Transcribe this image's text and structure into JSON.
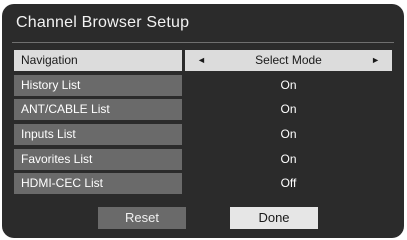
{
  "title": "Channel Browser Setup",
  "menu": {
    "items": [
      {
        "label": "Navigation",
        "value": "Select Mode"
      },
      {
        "label": "History List",
        "value": "On"
      },
      {
        "label": "ANT/CABLE List",
        "value": "On"
      },
      {
        "label": "Inputs List",
        "value": "On"
      },
      {
        "label": "Favorites List",
        "value": "On"
      },
      {
        "label": "HDMI-CEC List",
        "value": "Off"
      }
    ]
  },
  "buttons": {
    "reset_label": "Reset",
    "done_label": "Done"
  },
  "icons": {
    "left_arrow": "◄",
    "right_arrow": "►"
  },
  "colors": {
    "panel_bg": "#2b2b2b",
    "label_bg": "#6a6a6a",
    "highlight_bg": "#dcdcdc"
  }
}
